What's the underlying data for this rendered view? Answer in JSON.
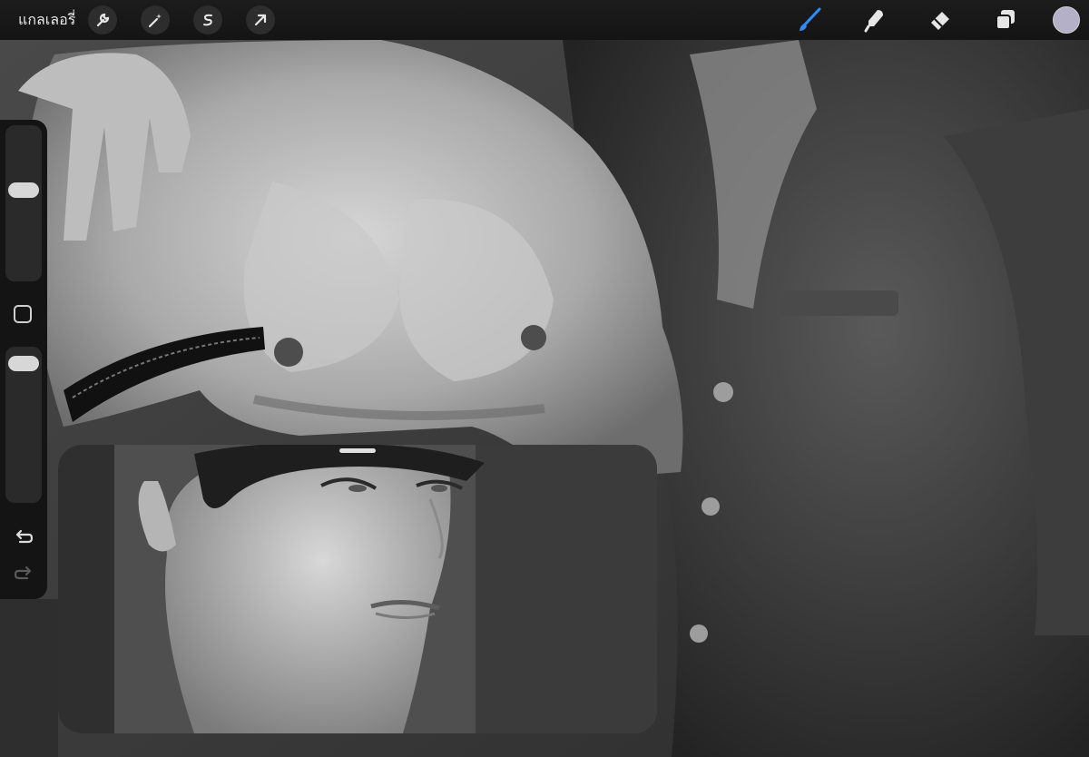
{
  "toolbar": {
    "gallery_label": "แกลเลอรี่",
    "left_tools": [
      {
        "name": "actions",
        "icon": "wrench-icon"
      },
      {
        "name": "adjustments",
        "icon": "magic-wand-icon"
      },
      {
        "name": "selection",
        "icon": "selection-s-icon"
      },
      {
        "name": "transform",
        "icon": "arrow-cursor-icon"
      }
    ],
    "right_tools": [
      {
        "name": "brush",
        "icon": "brush-icon",
        "active": true,
        "color": "#2e8cff"
      },
      {
        "name": "smudge",
        "icon": "smudge-finger-icon"
      },
      {
        "name": "eraser",
        "icon": "eraser-icon"
      },
      {
        "name": "layers",
        "icon": "layers-icon"
      }
    ],
    "current_color": "#b4b0c8"
  },
  "sidebar": {
    "brush_size_level": 0.6,
    "opacity_level": 0.95
  },
  "reference_window": {
    "visible": true
  },
  "colors": {
    "toolbar_bg": "#161616",
    "accent": "#2e8cff",
    "sidebar_bg": "#141414"
  }
}
